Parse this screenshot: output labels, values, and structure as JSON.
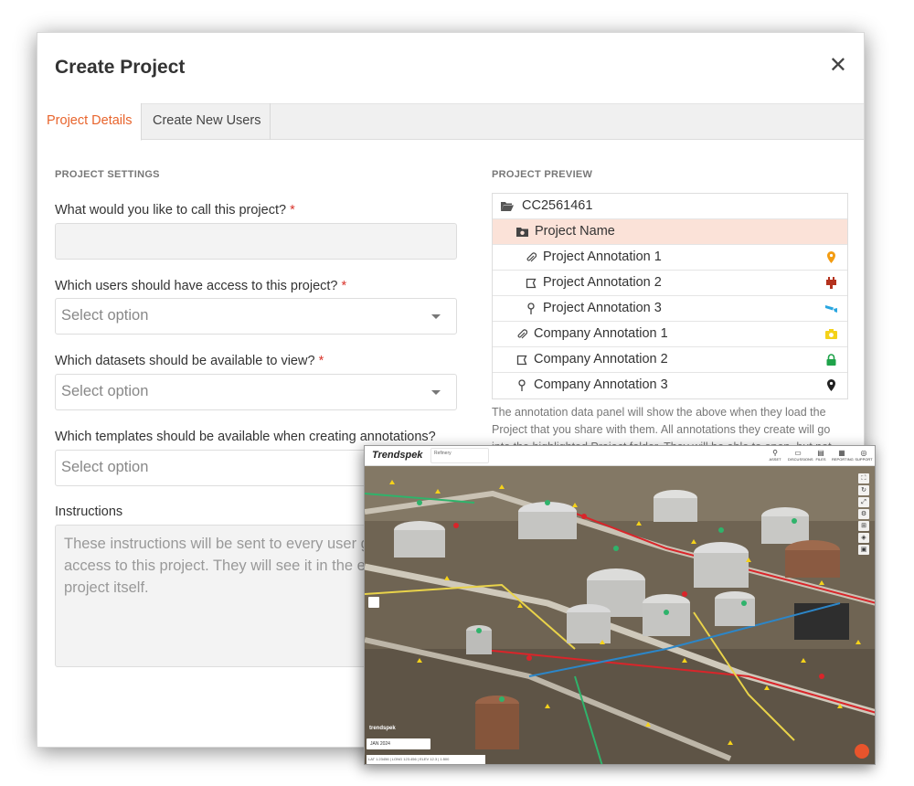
{
  "modal": {
    "title": "Create Project",
    "close_glyph": "✕"
  },
  "tabs": [
    {
      "label": "Project Details",
      "active": true
    },
    {
      "label": "Create New Users",
      "active": false
    }
  ],
  "settings": {
    "section_title": "PROJECT SETTINGS",
    "q_name": "What would you like to call this project?",
    "q_users": "Which users should have access to this project?",
    "q_datasets": "Which datasets should be available to view?",
    "q_templates": "Which templates should be available when creating annotations?",
    "required_mark": "*",
    "name_value": "",
    "users_placeholder": "Select option",
    "datasets_placeholder": "Select option",
    "templates_placeholder": "Select option",
    "instructions_label": "Instructions",
    "instructions_placeholder": "These instructions will be sent to every user given access to this project. They will see it in the email and the project itself."
  },
  "preview": {
    "section_title": "PROJECT PREVIEW",
    "rows": [
      {
        "label": "CC2561461",
        "icon": "folder-open-icon"
      },
      {
        "label": "Project Name",
        "icon": "camera-folder-icon",
        "highlight": true
      },
      {
        "label": "Project Annotation 1",
        "icon": "paperclip-icon",
        "badge": "map-pin-icon",
        "badge_color": "#f39c12"
      },
      {
        "label": "Project Annotation 2",
        "icon": "polygon-icon",
        "badge": "plug-icon",
        "badge_color": "#b4321e"
      },
      {
        "label": "Project Annotation 3",
        "icon": "map-marker-icon",
        "badge": "security-camera-icon",
        "badge_color": "#29a6e0"
      },
      {
        "label": "Company Annotation 1",
        "icon": "paperclip-icon",
        "badge": "camera-icon",
        "badge_color": "#f4d21a"
      },
      {
        "label": "Company Annotation 2",
        "icon": "polygon-icon",
        "badge": "lock-icon",
        "badge_color": "#1fa34a"
      },
      {
        "label": "Company Annotation 3",
        "icon": "map-marker-icon",
        "badge": "map-pin-icon",
        "badge_color": "#222222"
      }
    ],
    "note": "The annotation data panel will show the above when they load the Project that you share with them. All annotations they create will go into the highlighted Project folder. They will be able to open, but not"
  },
  "app_screenshot": {
    "logo": "Trendspek",
    "project_label": "Refinery",
    "nav": [
      {
        "label": "ASSET",
        "icon": "pin-icon"
      },
      {
        "label": "DISCUSSIONS",
        "icon": "chat-icon"
      },
      {
        "label": "FILES",
        "icon": "files-icon"
      },
      {
        "label": "REPORTING",
        "icon": "report-icon"
      },
      {
        "label": "SUPPORT",
        "icon": "help-icon"
      }
    ],
    "watermark": "trendspek",
    "bottom_label": "JAN 2024",
    "status": "LAT 1.23456 | LONG 123.456 | ELEV 12.3 | 1:500"
  }
}
